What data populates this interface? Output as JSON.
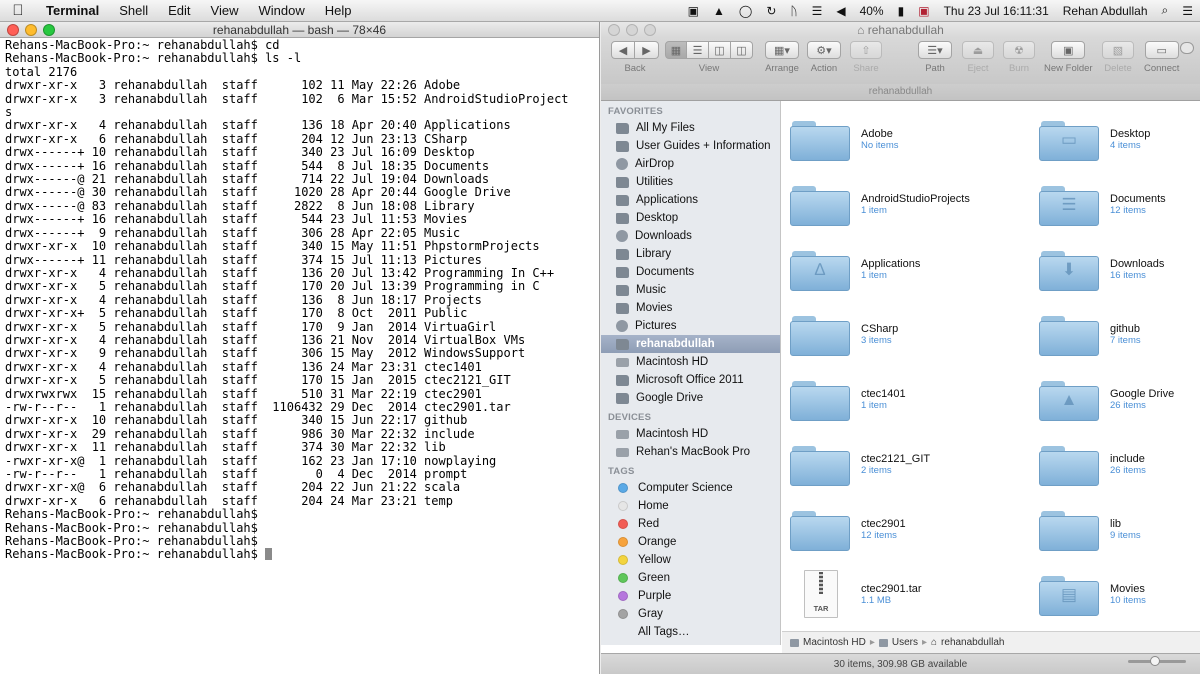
{
  "menubar": {
    "apple_icon": "",
    "menus": [
      "Terminal",
      "Shell",
      "Edit",
      "View",
      "Window",
      "Help"
    ],
    "battery": "40%",
    "flag_icon": "uk-flag-icon",
    "datetime": "Thu 23 Jul  16:11:31",
    "user": "Rehan Abdullah",
    "search_icon": "⌕",
    "list_icon": "☰"
  },
  "terminal": {
    "title": "rehanabdullah — bash — 78×46",
    "lines": [
      "Rehans-MacBook-Pro:~ rehanabdullah$ cd",
      "Rehans-MacBook-Pro:~ rehanabdullah$ ls -l",
      "total 2176",
      "drwxr-xr-x   3 rehanabdullah  staff      102 11 May 22:26 Adobe",
      "drwxr-xr-x   3 rehanabdullah  staff      102  6 Mar 15:52 AndroidStudioProject",
      "s",
      "drwxr-xr-x   4 rehanabdullah  staff      136 18 Apr 20:40 Applications",
      "drwxr-xr-x   6 rehanabdullah  staff      204 12 Jun 23:13 CSharp",
      "drwx------+ 10 rehanabdullah  staff      340 23 Jul 16:09 Desktop",
      "drwx------+ 16 rehanabdullah  staff      544  8 Jul 18:35 Documents",
      "drwx------@ 21 rehanabdullah  staff      714 22 Jul 19:04 Downloads",
      "drwx------@ 30 rehanabdullah  staff     1020 28 Apr 20:44 Google Drive",
      "drwx------@ 83 rehanabdullah  staff     2822  8 Jun 18:08 Library",
      "drwx------+ 16 rehanabdullah  staff      544 23 Jul 11:53 Movies",
      "drwx------+  9 rehanabdullah  staff      306 28 Apr 22:05 Music",
      "drwxr-xr-x  10 rehanabdullah  staff      340 15 May 11:51 PhpstormProjects",
      "drwx------+ 11 rehanabdullah  staff      374 15 Jul 11:13 Pictures",
      "drwxr-xr-x   4 rehanabdullah  staff      136 20 Jul 13:42 Programming In C++",
      "drwxr-xr-x   5 rehanabdullah  staff      170 20 Jul 13:39 Programming in C",
      "drwxr-xr-x   4 rehanabdullah  staff      136  8 Jun 18:17 Projects",
      "drwxr-xr-x+  5 rehanabdullah  staff      170  8 Oct  2011 Public",
      "drwxr-xr-x   5 rehanabdullah  staff      170  9 Jan  2014 VirtuaGirl",
      "drwxr-xr-x   4 rehanabdullah  staff      136 21 Nov  2014 VirtualBox VMs",
      "drwxr-xr-x   9 rehanabdullah  staff      306 15 May  2012 WindowsSupport",
      "drwxr-xr-x   4 rehanabdullah  staff      136 24 Mar 23:31 ctec1401",
      "drwxr-xr-x   5 rehanabdullah  staff      170 15 Jan  2015 ctec2121_GIT",
      "drwxrwxrwx  15 rehanabdullah  staff      510 31 Mar 22:19 ctec2901",
      "-rw-r--r--   1 rehanabdullah  staff  1106432 29 Dec  2014 ctec2901.tar",
      "drwxr-xr-x  10 rehanabdullah  staff      340 15 Jun 22:17 github",
      "drwxr-xr-x  29 rehanabdullah  staff      986 30 Mar 22:32 include",
      "drwxr-xr-x  11 rehanabdullah  staff      374 30 Mar 22:32 lib",
      "-rwxr-xr-x@  1 rehanabdullah  staff      162 23 Jan 17:10 nowplaying",
      "-rw-r--r--   1 rehanabdullah  staff        0  4 Dec  2014 prompt",
      "drwxr-xr-x@  6 rehanabdullah  staff      204 22 Jun 21:22 scala",
      "drwxr-xr-x   6 rehanabdullah  staff      204 24 Mar 23:21 temp",
      "Rehans-MacBook-Pro:~ rehanabdullah$",
      "Rehans-MacBook-Pro:~ rehanabdullah$",
      "Rehans-MacBook-Pro:~ rehanabdullah$",
      "Rehans-MacBook-Pro:~ rehanabdullah$ "
    ]
  },
  "finder": {
    "title": "rehanabdullah",
    "toolbar": {
      "back": "Back",
      "view": "View",
      "arrange": "Arrange",
      "action": "Action",
      "share": "Share",
      "path": "Path",
      "eject": "Eject",
      "burn": "Burn",
      "new_folder": "New Folder",
      "delete": "Delete",
      "connect": "Connect"
    },
    "path_title": "rehanabdullah",
    "sidebar": {
      "favorites_head": "FAVORITES",
      "favorites": [
        "All My Files",
        "User Guides + Information",
        "AirDrop",
        "Utilities",
        "Applications",
        "Desktop",
        "Downloads",
        "Library",
        "Documents",
        "Music",
        "Movies",
        "Pictures",
        "rehanabdullah",
        "Macintosh HD",
        "Microsoft Office 2011",
        "Google Drive"
      ],
      "devices_head": "DEVICES",
      "devices": [
        "Macintosh HD",
        "Rehan's MacBook Pro"
      ],
      "tags_head": "TAGS",
      "tags": [
        {
          "label": "Computer Science",
          "color": "#5aa9e6"
        },
        {
          "label": "Home",
          "color": "#e6e6e6"
        },
        {
          "label": "Red",
          "color": "#f25c54"
        },
        {
          "label": "Orange",
          "color": "#f7a33c"
        },
        {
          "label": "Yellow",
          "color": "#f3d43e"
        },
        {
          "label": "Green",
          "color": "#5fc65a"
        },
        {
          "label": "Purple",
          "color": "#b676dd"
        },
        {
          "label": "Gray",
          "color": "#a3a3a3"
        },
        {
          "label": "All Tags…",
          "color": ""
        }
      ]
    },
    "items": [
      {
        "name": "Adobe",
        "sub": "No items",
        "icon": "folder"
      },
      {
        "name": "Desktop",
        "sub": "4 items",
        "icon": "desktop-folder"
      },
      {
        "name": "AndroidStudioProjects",
        "sub": "1 item",
        "icon": "folder"
      },
      {
        "name": "Documents",
        "sub": "12 items",
        "icon": "documents-folder"
      },
      {
        "name": "Applications",
        "sub": "1 item",
        "icon": "applications-folder"
      },
      {
        "name": "Downloads",
        "sub": "16 items",
        "icon": "downloads-folder"
      },
      {
        "name": "CSharp",
        "sub": "3 items",
        "icon": "folder"
      },
      {
        "name": "github",
        "sub": "7 items",
        "icon": "folder"
      },
      {
        "name": "ctec1401",
        "sub": "1 item",
        "icon": "folder"
      },
      {
        "name": "Google Drive",
        "sub": "26 items",
        "icon": "google-drive-folder"
      },
      {
        "name": "ctec2121_GIT",
        "sub": "2 items",
        "icon": "folder"
      },
      {
        "name": "include",
        "sub": "26 items",
        "icon": "folder"
      },
      {
        "name": "ctec2901",
        "sub": "12 items",
        "icon": "folder"
      },
      {
        "name": "lib",
        "sub": "9 items",
        "icon": "folder"
      },
      {
        "name": "ctec2901.tar",
        "sub": "1.1 MB",
        "icon": "tar-archive"
      },
      {
        "name": "Movies",
        "sub": "10 items",
        "icon": "movies-folder"
      }
    ],
    "tar_label": "TAR",
    "pathbar": [
      "Macintosh HD",
      "Users",
      "rehanabdullah"
    ],
    "status": "30 items, 309.98 GB available",
    "zoom_level": 0.45
  }
}
